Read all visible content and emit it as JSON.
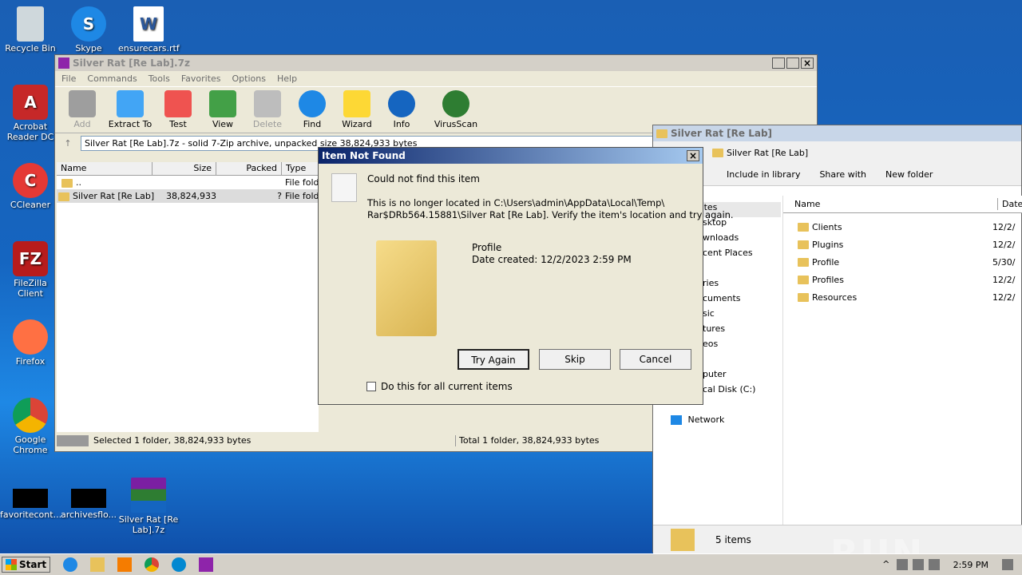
{
  "desktop": {
    "icons": [
      {
        "label": "Recycle Bin"
      },
      {
        "label": "Skype"
      },
      {
        "label": "ensurecars.rtf"
      },
      {
        "label": "Acrobat Reader DC"
      },
      {
        "label": "CCleaner"
      },
      {
        "label": "FileZilla Client"
      },
      {
        "label": "Firefox"
      },
      {
        "label": "Google Chrome"
      },
      {
        "label": "favoritecont..."
      },
      {
        "label": "archivesflo..."
      },
      {
        "label": "Silver Rat [Re Lab].7z"
      }
    ]
  },
  "zip_window": {
    "title": "Silver Rat [Re Lab].7z",
    "menu": [
      "File",
      "Commands",
      "Tools",
      "Favorites",
      "Options",
      "Help"
    ],
    "toolbar": [
      "Add",
      "Extract To",
      "Test",
      "View",
      "Delete",
      "Find",
      "Wizard",
      "Info",
      "VirusScan"
    ],
    "address": "Silver Rat [Re Lab].7z - solid 7-Zip archive, unpacked size 38,824,933 bytes",
    "columns": [
      "Name",
      "Size",
      "Packed",
      "Type"
    ],
    "rows": [
      {
        "name": "..",
        "size": "",
        "packed": "",
        "type": "File folder"
      },
      {
        "name": "Silver Rat [Re Lab]",
        "size": "38,824,933",
        "packed": "?",
        "type": "File folder"
      }
    ],
    "status_left": "Selected 1 folder, 38,824,933 bytes",
    "status_right": "Total 1 folder, 38,824,933 bytes"
  },
  "explorer": {
    "title": "Silver Rat [Re Lab]",
    "breadcrumb": "Silver Rat [Re Lab]",
    "commands": [
      "Include in library",
      "Share with",
      "New folder"
    ],
    "nav": [
      "rites",
      "sktop",
      "wnloads",
      "cent Places",
      "ries",
      "cuments",
      "sic",
      "tures",
      "eos",
      "puter",
      "cal Disk (C:)",
      "Network"
    ],
    "col_name": "Name",
    "col_date": "Date",
    "files": [
      {
        "name": "Clients",
        "date": "12/2/"
      },
      {
        "name": "Plugins",
        "date": "12/2/"
      },
      {
        "name": "Profile",
        "date": "5/30/"
      },
      {
        "name": "Profiles",
        "date": "12/2/"
      },
      {
        "name": "Resources",
        "date": "12/2/"
      }
    ],
    "item_count": "5 items"
  },
  "dialog": {
    "title": "Item Not Found",
    "heading": "Could not find this item",
    "message_line1": "This is no longer located in C:\\Users\\admin\\AppData\\Local\\Temp\\",
    "message_line2": "Rar$DRb564.15881\\Silver Rat [Re Lab]. Verify the item's location and try again.",
    "item_name": "Profile",
    "item_date": "Date created: 12/2/2023 2:59 PM",
    "try_again": "Try Again",
    "skip": "Skip",
    "cancel": "Cancel",
    "checkbox_label": "Do this for all current items"
  },
  "taskbar": {
    "start": "Start",
    "time": "2:59 PM"
  },
  "watermark": "ANY RUN"
}
